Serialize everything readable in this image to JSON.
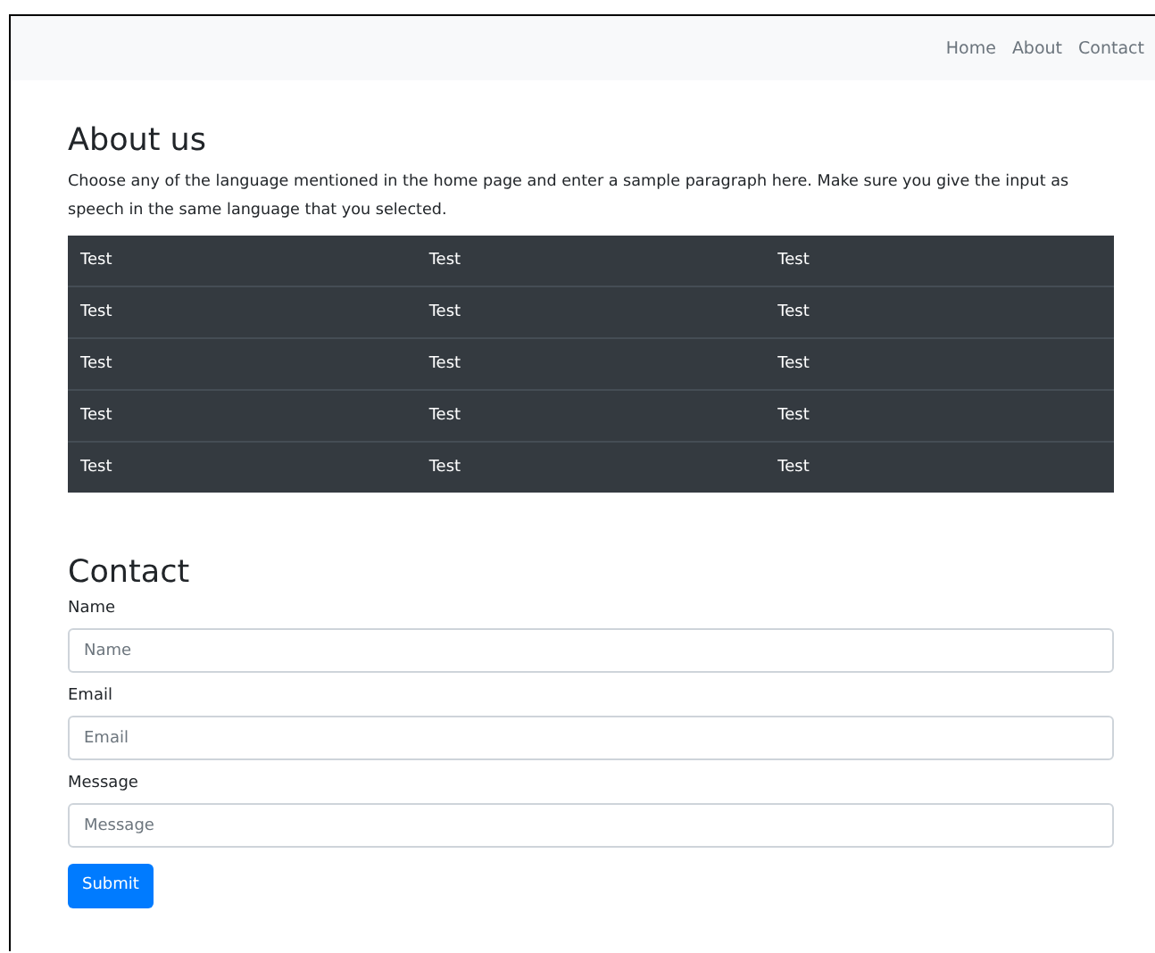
{
  "nav": {
    "links": [
      "Home",
      "About",
      "Contact"
    ]
  },
  "about": {
    "title": "About us",
    "text": "Choose any of the language mentioned in the home page and enter a sample paragraph here. Make sure you give the input as speech in the same language that you selected.",
    "table": {
      "rows": [
        [
          "Test",
          "Test",
          "Test"
        ],
        [
          "Test",
          "Test",
          "Test"
        ],
        [
          "Test",
          "Test",
          "Test"
        ],
        [
          "Test",
          "Test",
          "Test"
        ],
        [
          "Test",
          "Test",
          "Test"
        ]
      ]
    }
  },
  "contact": {
    "title": "Contact",
    "fields": [
      {
        "label": "Name",
        "placeholder": "Name"
      },
      {
        "label": "Email",
        "placeholder": "Email"
      },
      {
        "label": "Message",
        "placeholder": "Message"
      }
    ],
    "submit": "Submit"
  }
}
